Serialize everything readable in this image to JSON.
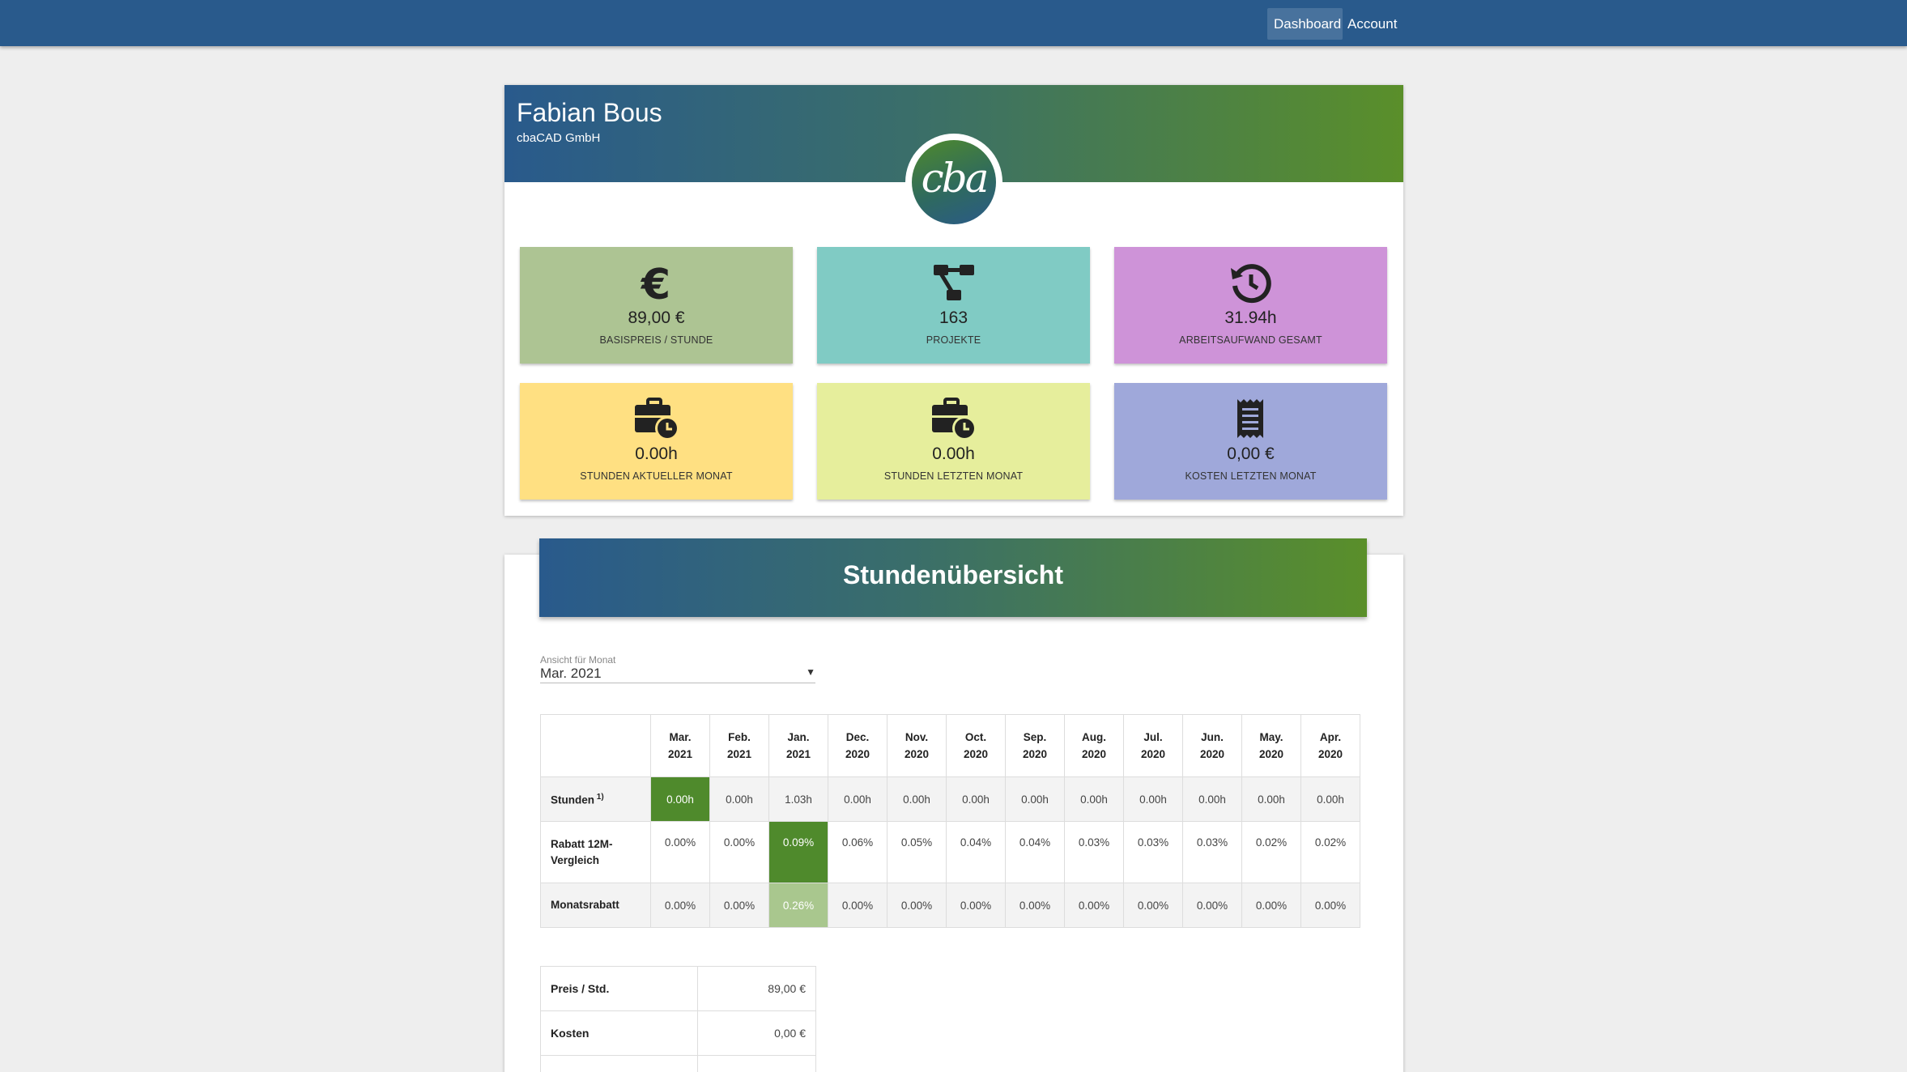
{
  "nav": {
    "dashboard": "Dashboard",
    "account": "Account"
  },
  "profile": {
    "name": "Fabian Bous",
    "company": "cbaCAD GmbH",
    "logo_text": "cba"
  },
  "tiles": [
    {
      "icon": "euro-icon",
      "value": "89,00 €",
      "label": "BASISPREIS / STUNDE",
      "color": "#adc493"
    },
    {
      "icon": "project-diagram-icon",
      "value": "163",
      "label": "PROJEKTE",
      "color": "#80cbc4"
    },
    {
      "icon": "history-icon",
      "value": "31.94h",
      "label": "ARBEITSAUFWAND GESAMT",
      "color": "#ce93d8"
    },
    {
      "icon": "briefcase-clock-icon",
      "value": "0.00h",
      "label": "STUNDEN AKTUELLER MONAT",
      "color": "#ffe082"
    },
    {
      "icon": "briefcase-clock-icon",
      "value": "0.00h",
      "label": "STUNDEN LETZTEN MONAT",
      "color": "#e6ee9c"
    },
    {
      "icon": "receipt-icon",
      "value": "0,00 €",
      "label": "KOSTEN LETZTEN MONAT",
      "color": "#9fa8da"
    }
  ],
  "hours": {
    "title": "Stundenübersicht",
    "select_label": "Ansicht für Monat",
    "select_value": "Mar. 2021",
    "months": [
      [
        "Mar.",
        "2021"
      ],
      [
        "Feb.",
        "2021"
      ],
      [
        "Jan.",
        "2021"
      ],
      [
        "Dec.",
        "2020"
      ],
      [
        "Nov.",
        "2020"
      ],
      [
        "Oct.",
        "2020"
      ],
      [
        "Sep.",
        "2020"
      ],
      [
        "Aug.",
        "2020"
      ],
      [
        "Jul.",
        "2020"
      ],
      [
        "Jun.",
        "2020"
      ],
      [
        "May.",
        "2020"
      ],
      [
        "Apr.",
        "2020"
      ]
    ],
    "rows": [
      {
        "label": "Stunden",
        "sup": "1)",
        "values": [
          "0.00h",
          "0.00h",
          "1.03h",
          "0.00h",
          "0.00h",
          "0.00h",
          "0.00h",
          "0.00h",
          "0.00h",
          "0.00h",
          "0.00h",
          "0.00h"
        ],
        "highlight": 0
      },
      {
        "label": "Rabatt 12M-Vergleich",
        "values": [
          "0.00%",
          "0.00%",
          "0.09%",
          "0.06%",
          "0.05%",
          "0.04%",
          "0.04%",
          "0.03%",
          "0.03%",
          "0.03%",
          "0.02%",
          "0.02%"
        ],
        "highlight": 2
      },
      {
        "label": "Monatsrabatt",
        "values": [
          "0.00%",
          "0.00%",
          "0.26%",
          "0.00%",
          "0.00%",
          "0.00%",
          "0.00%",
          "0.00%",
          "0.00%",
          "0.00%",
          "0.00%",
          "0.00%"
        ],
        "highlight": 2
      }
    ],
    "price_rows": [
      {
        "label": "Preis / Std.",
        "value": "89,00 €"
      },
      {
        "label": "Kosten",
        "value": "0,00 €"
      },
      {
        "label": "",
        "value": ""
      }
    ]
  }
}
